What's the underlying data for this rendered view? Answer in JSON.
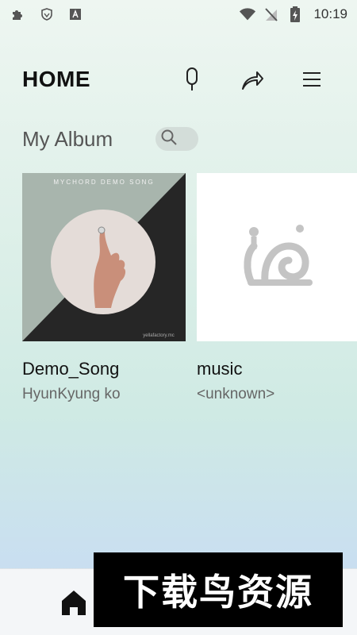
{
  "status_bar": {
    "time": "10:19",
    "left_icons": [
      "puzzle-icon",
      "shield-icon",
      "keyboard-a-icon"
    ],
    "right_icons": [
      "wifi-icon",
      "no-signal-icon",
      "battery-charging-icon"
    ]
  },
  "header": {
    "title": "HOME",
    "icons": [
      "microphone-icon",
      "share-icon",
      "menu-icon"
    ]
  },
  "section": {
    "title": "My Album",
    "search_icon": "search-icon"
  },
  "albums": [
    {
      "name": "Demo_Song",
      "artist": "HyunKyung ko",
      "cover_text": "MYCHORD DEMO SONG",
      "cover_footer": "yellafactory.mc"
    },
    {
      "name": "music",
      "artist": "<unknown>",
      "cover_icon": "snail-placeholder-icon"
    }
  ],
  "bottom_nav": {
    "items": [
      "home-icon"
    ]
  },
  "watermark": {
    "text": "下载鸟资源"
  },
  "colors": {
    "background_top": "#eef6f1",
    "background_bottom": "#c6d2ee",
    "title": "#111111",
    "subtitle": "#666666"
  }
}
